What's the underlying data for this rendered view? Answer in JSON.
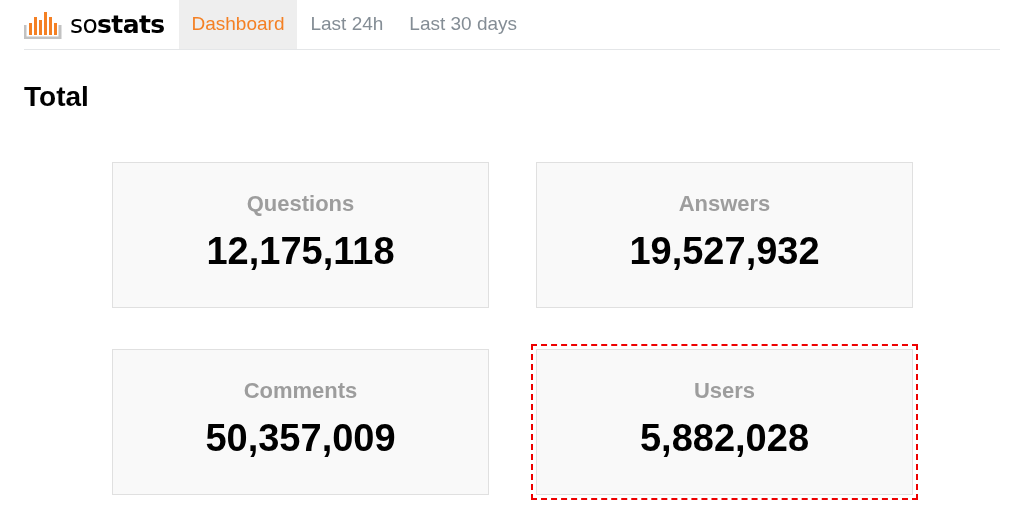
{
  "logo": {
    "text": "so**stats**"
  },
  "tabs": [
    {
      "label": "Dashboard",
      "selected": true
    },
    {
      "label": "Last 24h",
      "selected": false
    },
    {
      "label": "Last 30 days",
      "selected": false
    }
  ],
  "heading": "Total",
  "cards": [
    {
      "label": "Questions",
      "value": "12,175,118",
      "highlighted": false
    },
    {
      "label": "Answers",
      "value": "19,527,932",
      "highlighted": false
    },
    {
      "label": "Comments",
      "value": "50,357,009",
      "highlighted": false
    },
    {
      "label": "Users",
      "value": "5,882,028",
      "highlighted": true
    }
  ]
}
